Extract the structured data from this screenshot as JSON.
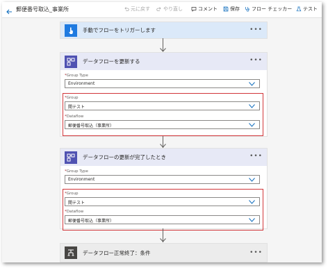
{
  "header": {
    "flow_title": "郵便番号取込_事業所",
    "toolbar": {
      "undo": "元に戻す",
      "redo": "やり直し",
      "comment": "コメント",
      "save": "保存",
      "flow_checker": "フロー チェッカー",
      "test": "テスト"
    }
  },
  "trigger": {
    "title": "手動でフローをトリガーします",
    "accent": "#1f7ae0"
  },
  "action1": {
    "title": "データフローを更新する",
    "group_type_label": "Group Type",
    "group_type_value": "Environment",
    "group_label": "Group",
    "group_value": "開テスト",
    "dataflow_label": "Dataflow",
    "dataflow_value": "郵便番号取込（事業所）",
    "accent": "#4f52b2"
  },
  "action2": {
    "title": "データフローの更新が完了したとき",
    "group_type_label": "Group Type",
    "group_type_value": "Environment",
    "group_label": "Group",
    "group_value": "開テスト",
    "dataflow_label": "Dataflow",
    "dataflow_value": "郵便番号取込（事業所）",
    "accent": "#4f52b2"
  },
  "condition": {
    "title": "データフロー正常終了：条件",
    "accent": "#484644"
  },
  "colors": {
    "highlight_border": "#d13438",
    "required_mark": "#a4262c"
  }
}
